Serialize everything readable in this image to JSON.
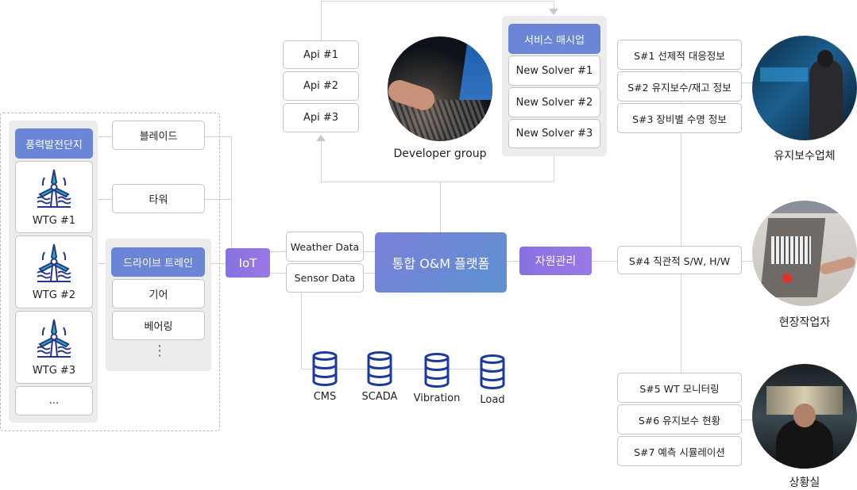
{
  "farm": {
    "title": "풍력발전단지",
    "turbines": [
      "WTG #1",
      "WTG #2",
      "WTG #3"
    ],
    "more": "..."
  },
  "components": {
    "blade": "블레이드",
    "tower": "타워",
    "drivetrain": "드라이브 트레인",
    "gear": "기어",
    "bearing": "베어링",
    "more": "⋮"
  },
  "iot": "IoT",
  "data_inputs": [
    "Weather Data",
    "Sensor Data"
  ],
  "databases": [
    "CMS",
    "SCADA",
    "Vibration",
    "Load"
  ],
  "platform": "통합 O&M 플랫폼",
  "resource": "자원관리",
  "apis": [
    "Api #1",
    "Api #2",
    "Api #3"
  ],
  "developer": "Developer group",
  "marketplace": {
    "title": "서비스 매시업",
    "solvers": [
      "New Solver #1",
      "New Solver #2",
      "New Solver #3"
    ]
  },
  "services": [
    "S#1 선제적 대응정보",
    "S#2 유지보수/재고 정보",
    "S#3 장비별 수명 정보",
    "S#4 직관적 S/W, H/W",
    "S#5 WT 모니터링",
    "S#6 유지보수 현황",
    "S#7 예측 시뮬레이션"
  ],
  "users": [
    "유지보수업체",
    "현장작업자",
    "상황실"
  ],
  "colors": {
    "header": "#6b86d6",
    "purple": "#8f75e3",
    "db": "#1a3a9c",
    "turbine": "#27348b",
    "turbine_accent": "#1fb5b0"
  }
}
